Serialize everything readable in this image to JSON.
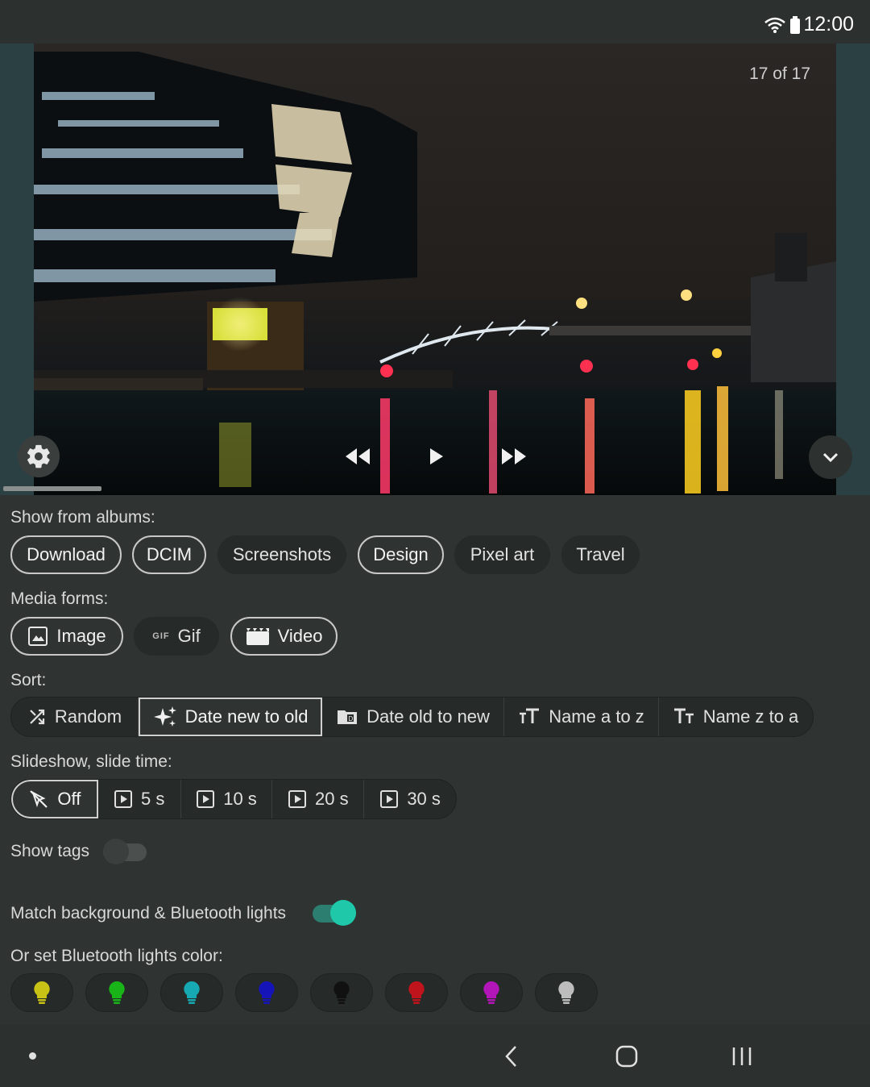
{
  "status_bar": {
    "time": "12:00"
  },
  "viewer": {
    "counter": "17 of 17",
    "progress_fraction": 0.11
  },
  "albums": {
    "label": "Show from albums:",
    "items": [
      {
        "label": "Download",
        "selected": true
      },
      {
        "label": "DCIM",
        "selected": true
      },
      {
        "label": "Screenshots",
        "selected": false
      },
      {
        "label": "Design",
        "selected": true
      },
      {
        "label": "Pixel art",
        "selected": false
      },
      {
        "label": "Travel",
        "selected": false
      }
    ]
  },
  "media_forms": {
    "label": "Media forms:",
    "items": [
      {
        "label": "Image",
        "icon": "image-icon",
        "selected": true
      },
      {
        "label": "Gif",
        "icon": "gif-icon",
        "icon_text": "GIF",
        "selected": false
      },
      {
        "label": "Video",
        "icon": "clapperboard-icon",
        "selected": true
      }
    ]
  },
  "sort": {
    "label": "Sort:",
    "items": [
      {
        "label": "Random",
        "icon": "shuffle-icon",
        "selected": false
      },
      {
        "label": "Date new to old",
        "icon": "sparkle-icon",
        "selected": true
      },
      {
        "label": "Date old to new",
        "icon": "folder-date-icon",
        "selected": false
      },
      {
        "label": "Name a to z",
        "icon": "text-size-icon",
        "selected": false
      },
      {
        "label": "Name z to a",
        "icon": "text-size-reverse-icon",
        "selected": false
      }
    ]
  },
  "slideshow": {
    "label": "Slideshow, slide time:",
    "items": [
      {
        "label": "Off",
        "icon": "cursor-off-icon",
        "selected": true
      },
      {
        "label": "5 s",
        "icon": "play-box-icon",
        "selected": false
      },
      {
        "label": "10 s",
        "icon": "play-box-icon",
        "selected": false
      },
      {
        "label": "20 s",
        "icon": "play-box-icon",
        "selected": false
      },
      {
        "label": "30 s",
        "icon": "play-box-icon",
        "selected": false
      }
    ]
  },
  "show_tags": {
    "label": "Show tags",
    "on": false
  },
  "match_background": {
    "label": "Match background & Bluetooth lights",
    "on": true,
    "accent": "#1ec8a8"
  },
  "bt_colors": {
    "label": "Or set Bluetooth lights color:",
    "items": [
      {
        "name": "yellow",
        "color": "#c9c216"
      },
      {
        "name": "green",
        "color": "#18b418"
      },
      {
        "name": "cyan",
        "color": "#17a9b3"
      },
      {
        "name": "blue",
        "color": "#1414b8"
      },
      {
        "name": "black",
        "color": "#111111"
      },
      {
        "name": "red",
        "color": "#c0141c"
      },
      {
        "name": "magenta",
        "color": "#b316b8"
      },
      {
        "name": "white",
        "color": "#bdbdbd"
      }
    ]
  }
}
